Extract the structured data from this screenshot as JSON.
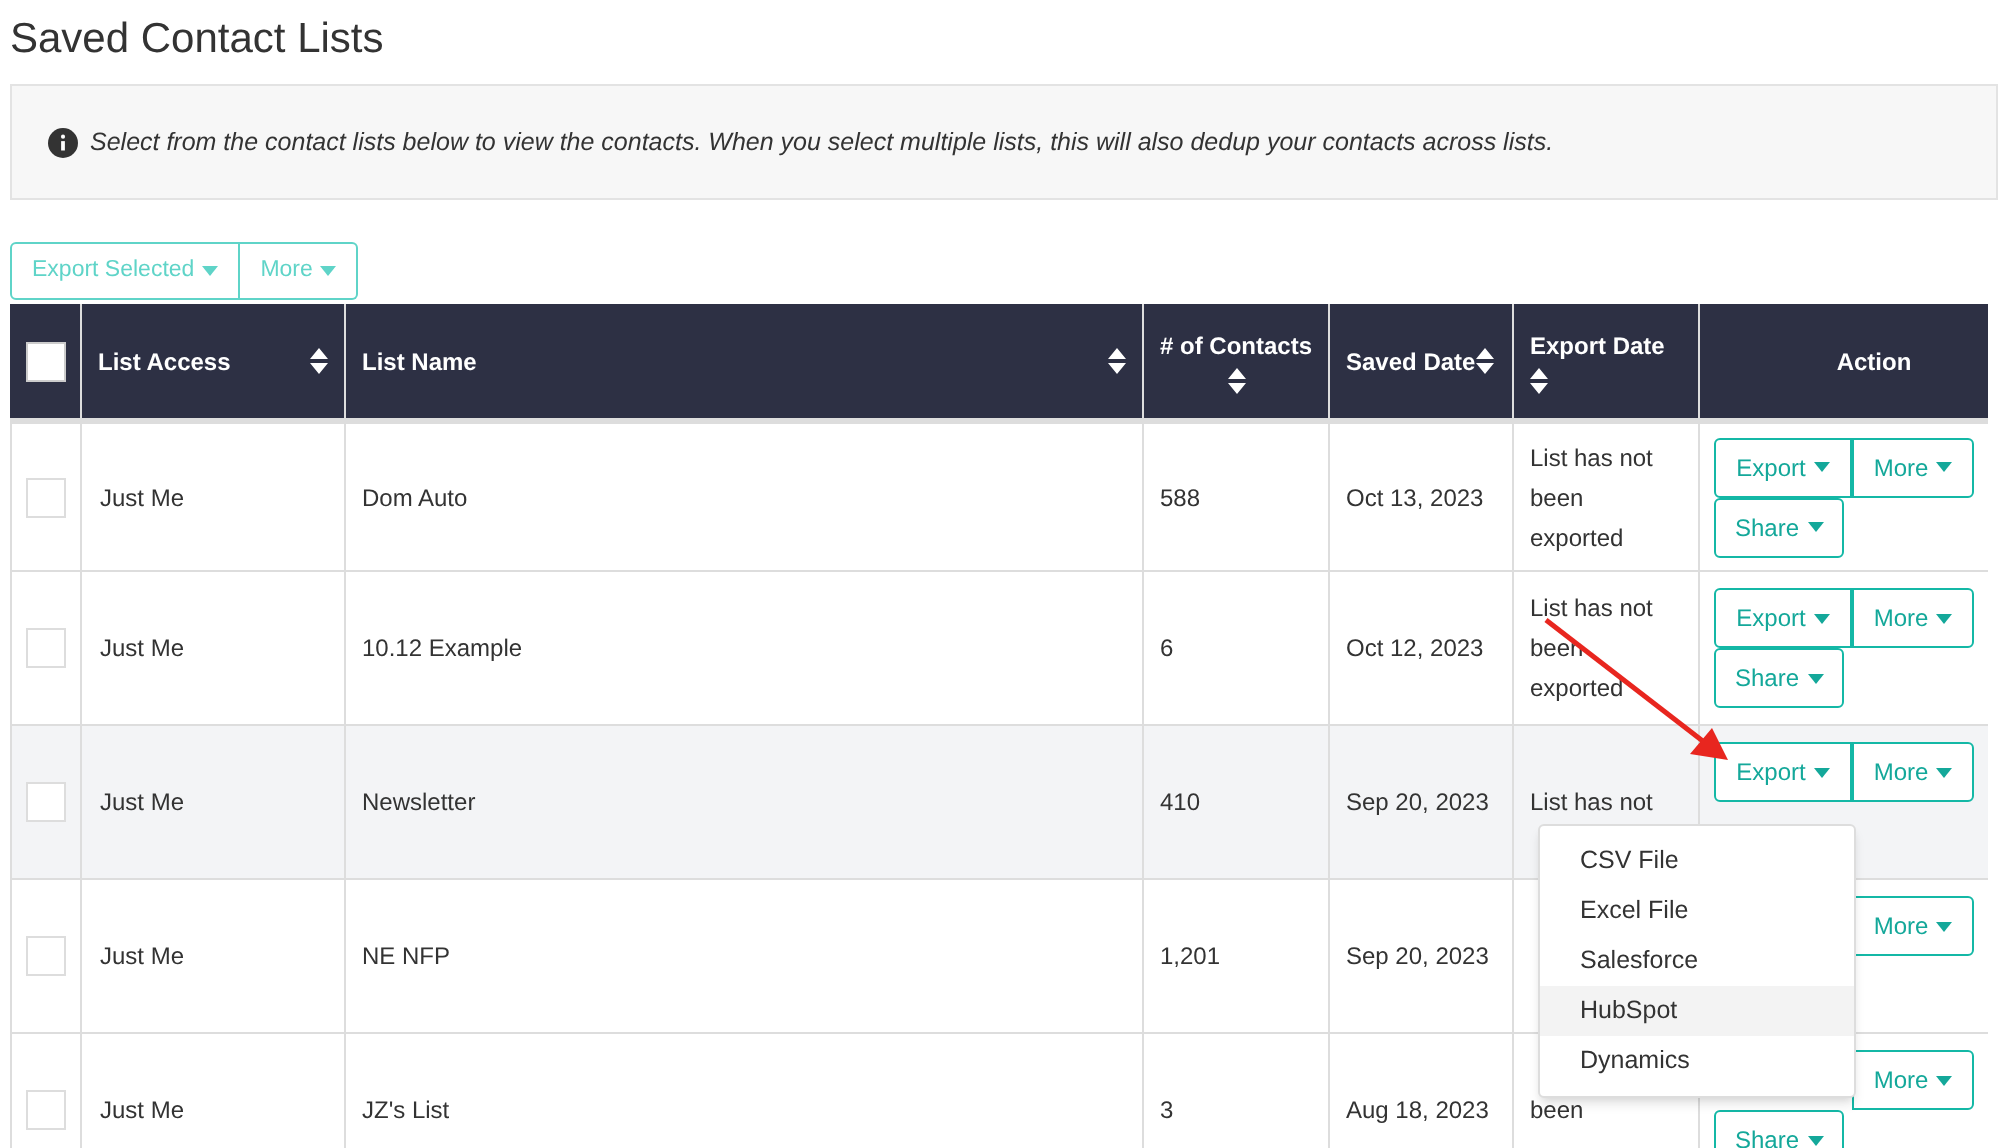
{
  "page_title": "Saved Contact Lists",
  "info": "Select from the contact lists below to view the contacts. When you select multiple lists, this will also dedup your contacts across lists.",
  "toolbar": [
    {
      "label": "Export Selected"
    },
    {
      "label": "More"
    }
  ],
  "table": {
    "select_all": {
      "checked": false
    },
    "columns": [
      {
        "label": "List Access",
        "sortable": true
      },
      {
        "label": "List Name",
        "sortable": true
      },
      {
        "label": "# of Contacts",
        "sortable": true
      },
      {
        "label": "Saved Date",
        "sortable": true
      },
      {
        "label": "Export Date",
        "sortable": true
      },
      {
        "label": "Action",
        "sortable": false
      }
    ],
    "rows": [
      {
        "checked": false,
        "hovered": false,
        "access": "Just Me",
        "name": "Dom Auto",
        "contacts": "588",
        "saved": "Oct 13, 2023",
        "export_date": [
          "List has not",
          "been",
          "exported"
        ],
        "actions": {
          "export": "Export",
          "more": "More",
          "share": "Share"
        }
      },
      {
        "checked": false,
        "hovered": false,
        "access": "Just Me",
        "name": "10.12 Example",
        "contacts": "6",
        "saved": "Oct 12, 2023",
        "export_date": [
          "List has not",
          "been",
          "exported"
        ],
        "actions": {
          "export": "Export",
          "more": "More",
          "share": "Share"
        }
      },
      {
        "checked": false,
        "hovered": true,
        "access": "Just Me",
        "name": "Newsletter",
        "contacts": "410",
        "saved": "Sep 20, 2023",
        "export_date": [
          "List has not"
        ],
        "actions": {
          "export": "Export",
          "more": "More"
        }
      },
      {
        "checked": false,
        "hovered": false,
        "access": "Just Me",
        "name": "NE NFP",
        "contacts": "1,201",
        "saved": "Sep 20, 2023",
        "actions": {
          "more": "More"
        }
      },
      {
        "checked": false,
        "hovered": false,
        "access": "Just Me",
        "name": "JZ's List",
        "contacts": "3",
        "saved": "Aug 18, 2023",
        "export_date": [
          "been"
        ],
        "actions": {
          "more": "More",
          "share": "Share"
        }
      }
    ]
  },
  "export_menu": {
    "items": [
      {
        "label": "CSV File",
        "highlighted": false
      },
      {
        "label": "Excel File",
        "highlighted": false
      },
      {
        "label": "Salesforce",
        "highlighted": false
      },
      {
        "label": "HubSpot",
        "highlighted": true
      },
      {
        "label": "Dynamics",
        "highlighted": false
      }
    ]
  }
}
